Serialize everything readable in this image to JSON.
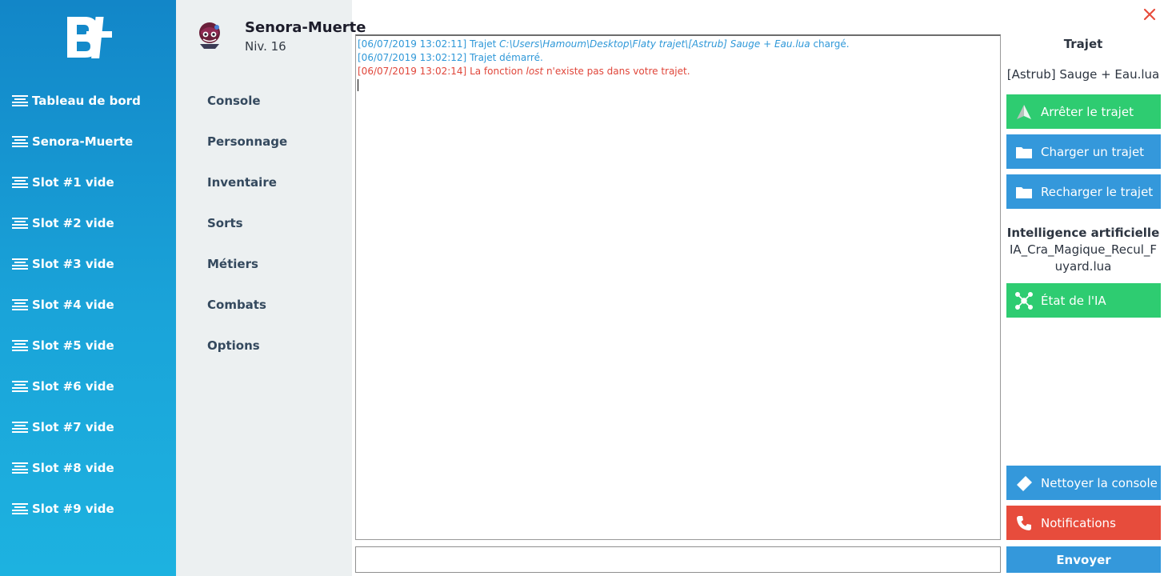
{
  "sidebar": {
    "items": [
      {
        "label": "Tableau de bord"
      },
      {
        "label": "Senora-Muerte"
      },
      {
        "label": "Slot #1 vide"
      },
      {
        "label": "Slot #2 vide"
      },
      {
        "label": "Slot #3 vide"
      },
      {
        "label": "Slot #4 vide"
      },
      {
        "label": "Slot #5 vide"
      },
      {
        "label": "Slot #6 vide"
      },
      {
        "label": "Slot #7 vide"
      },
      {
        "label": "Slot #8 vide"
      },
      {
        "label": "Slot #9 vide"
      }
    ]
  },
  "character": {
    "name": "Senora-Muerte",
    "level": "Niv. 16"
  },
  "menu": {
    "items": [
      {
        "label": "Console"
      },
      {
        "label": "Personnage"
      },
      {
        "label": "Inventaire"
      },
      {
        "label": "Sorts"
      },
      {
        "label": "Métiers"
      },
      {
        "label": "Combats"
      },
      {
        "label": "Options"
      }
    ]
  },
  "console": {
    "lines": [
      {
        "time": "[06/07/2019 13:02:11]",
        "pre": " Trajet ",
        "em": "C:\\Users\\Hamoum\\Desktop\\Flaty trajet\\[Astrub] Sauge + Eau.lua",
        "post": " chargé.",
        "color": "#2f98d8"
      },
      {
        "time": "[06/07/2019 13:02:12]",
        "pre": " Trajet démarré.",
        "em": "",
        "post": "",
        "color": "#2f98d8"
      },
      {
        "time": "[06/07/2019 13:02:14]",
        "pre": " La fonction ",
        "em": "lost",
        "post": " n'existe pas dans votre trajet.",
        "color": "#e0463a"
      }
    ]
  },
  "right_panel": {
    "trajet_title": "Trajet",
    "trajet_name": "[Astrub] Sauge + Eau.lua",
    "stop_label": "Arrêter le trajet",
    "load_label": "Charger un trajet",
    "reload_label": "Recharger le trajet",
    "ai_title": "Intelligence artificielle",
    "ai_file_line1": "IA_Cra_Magique_Recul_F",
    "ai_file_line2": "uyard.lua",
    "ai_state_label": "État de l'IA",
    "clear_label": "Nettoyer la console",
    "notifications_label": "Notifications",
    "send_label": "Envoyer"
  },
  "colors": {
    "sidebar": "#1aa4d9",
    "green": "#2ecc71",
    "blue": "#3498db",
    "red": "#e74c3c",
    "close": "#e74c3c"
  }
}
